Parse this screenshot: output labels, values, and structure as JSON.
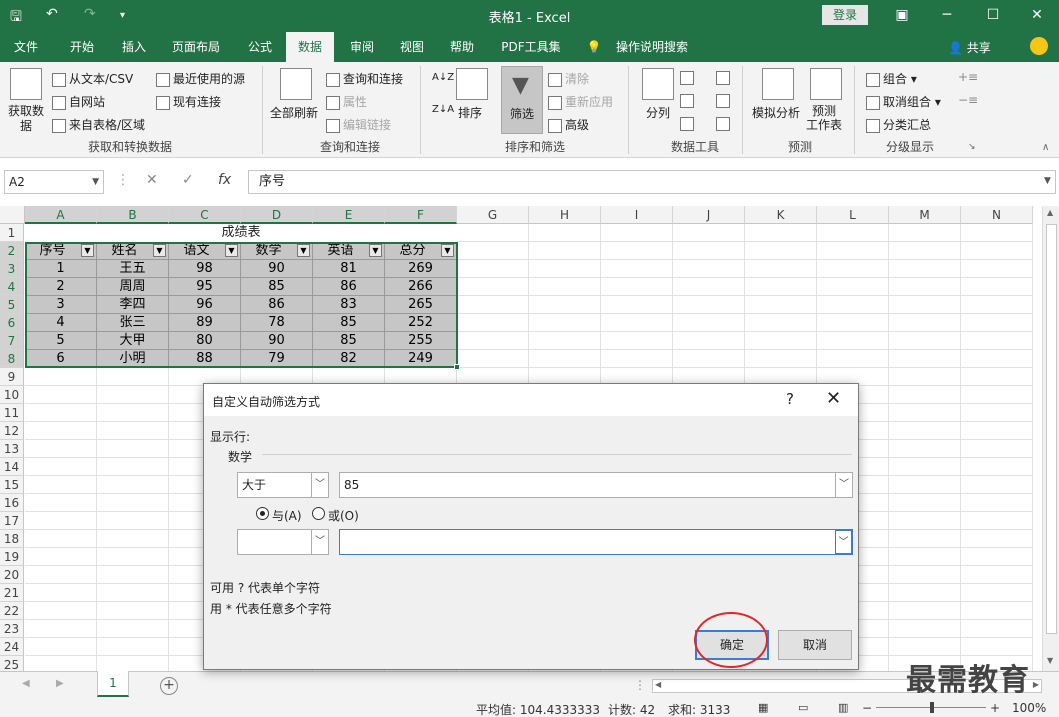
{
  "window": {
    "title": "表格1 - Excel",
    "login_label": "登录"
  },
  "tabs": [
    {
      "label": "文件"
    },
    {
      "label": "开始"
    },
    {
      "label": "插入"
    },
    {
      "label": "页面布局"
    },
    {
      "label": "公式"
    },
    {
      "label": "数据"
    },
    {
      "label": "审阅"
    },
    {
      "label": "视图"
    },
    {
      "label": "帮助"
    },
    {
      "label": "PDF工具集"
    },
    {
      "label": "操作说明搜索"
    }
  ],
  "share_label": "共享",
  "ribbon": {
    "get_data": "获取数据",
    "from_text_csv": "从文本/CSV",
    "from_web": "自网站",
    "from_table": "来自表格/区域",
    "recent_sources": "最近使用的源",
    "existing_connections": "现有连接",
    "group_get_transform": "获取和转换数据",
    "refresh_all": "全部刷新",
    "queries_connections": "查询和连接",
    "properties": "属性",
    "edit_links": "编辑链接",
    "group_queries": "查询和连接",
    "sort": "排序",
    "filter": "筛选",
    "clear": "清除",
    "reapply": "重新应用",
    "advanced": "高级",
    "group_sort_filter": "排序和筛选",
    "text_to_columns": "分列",
    "group_data_tools": "数据工具",
    "what_if": "模拟分析",
    "forecast_sheet": "预测\n工作表",
    "group_forecast": "预测",
    "group": "组合",
    "ungroup": "取消组合",
    "subtotal": "分类汇总",
    "group_outline": "分级显示"
  },
  "formula_bar": {
    "name_box": "A2",
    "content": "序号"
  },
  "columns": [
    "A",
    "B",
    "C",
    "D",
    "E",
    "F",
    "G",
    "H",
    "I",
    "J",
    "K",
    "L",
    "M",
    "N"
  ],
  "rows": [
    "1",
    "2",
    "3",
    "4",
    "5",
    "6",
    "7",
    "8",
    "9",
    "10",
    "11",
    "12",
    "13",
    "14",
    "15",
    "16",
    "17",
    "18",
    "19",
    "20",
    "21",
    "22",
    "23",
    "24",
    "25"
  ],
  "table": {
    "title": "成绩表",
    "headers": [
      "序号",
      "姓名",
      "语文",
      "数学",
      "英语",
      "总分"
    ],
    "rows": [
      [
        "1",
        "王五",
        "98",
        "90",
        "81",
        "269"
      ],
      [
        "2",
        "周周",
        "95",
        "85",
        "86",
        "266"
      ],
      [
        "3",
        "李四",
        "96",
        "86",
        "83",
        "265"
      ],
      [
        "4",
        "张三",
        "89",
        "78",
        "85",
        "252"
      ],
      [
        "5",
        "大甲",
        "80",
        "90",
        "85",
        "255"
      ],
      [
        "6",
        "小明",
        "88",
        "79",
        "82",
        "249"
      ]
    ]
  },
  "sheet_tab": "1",
  "status": {
    "average": "平均值: 104.4333333",
    "count": "计数: 42",
    "sum": "求和: 3133",
    "zoom": "100%"
  },
  "watermark": "最需教育",
  "dialog": {
    "title": "自定义自动筛选方式",
    "help": "?",
    "show_rows": "显示行:",
    "field": "数学",
    "condition1_operator": "大于",
    "condition1_value": "85",
    "and_label": "与(A)",
    "or_label": "或(O)",
    "condition2_operator": "",
    "condition2_value": "",
    "hint1": "可用 ? 代表单个字符",
    "hint2": "用 * 代表任意多个字符",
    "ok": "确定",
    "cancel": "取消"
  }
}
